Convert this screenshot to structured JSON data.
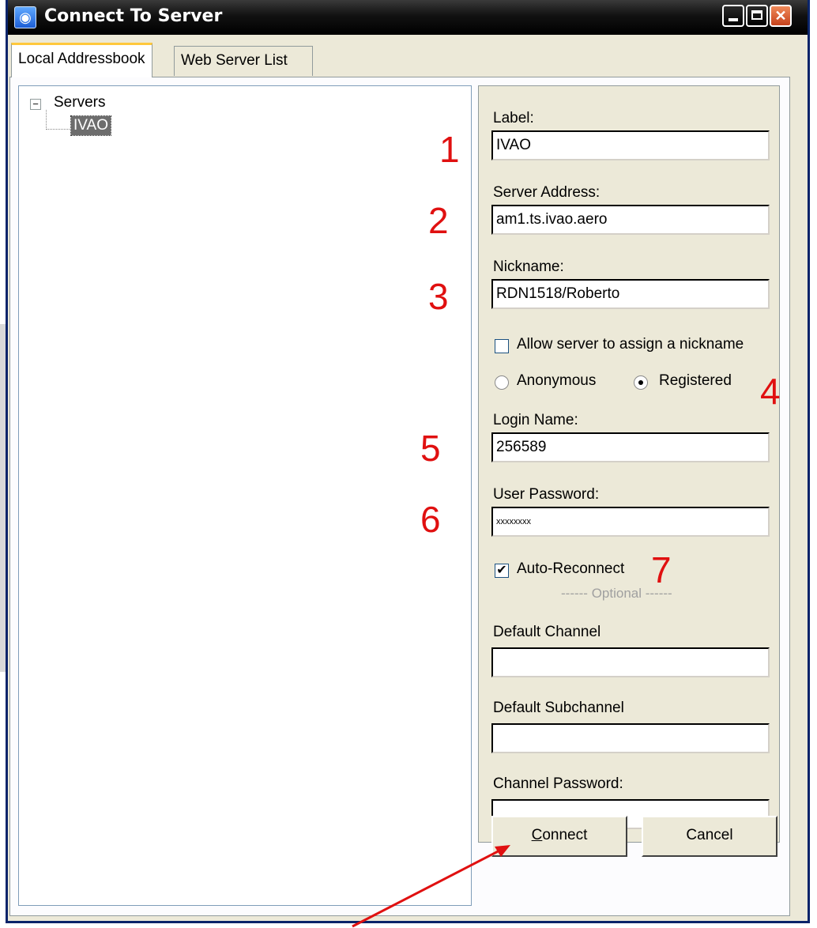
{
  "window": {
    "title": "Connect To Server"
  },
  "tabs": [
    "Local Addressbook",
    "Web Server List"
  ],
  "tree": {
    "root": "Servers",
    "child": "IVAO"
  },
  "form": {
    "label_caption": "Label:",
    "label_value": "IVAO",
    "server_caption": "Server Address:",
    "server_value": "am1.ts.ivao.aero",
    "nickname_caption": "Nickname:",
    "nickname_value": "RDN1518/Roberto",
    "allow_assign_label": "Allow server to assign a nickname",
    "allow_assign_checked": false,
    "anonymous_label": "Anonymous",
    "registered_label": "Registered",
    "login_caption": "Login Name:",
    "login_value": "256589",
    "password_caption": "User Password:",
    "password_value": "xxxxxxxx",
    "auto_reconnect_label": "Auto-Reconnect",
    "auto_reconnect_checked": true,
    "optional_label": "------ Optional ------",
    "default_channel_caption": "Default Channel",
    "default_channel_value": "",
    "default_subchannel_caption": "Default Subchannel",
    "default_subchannel_value": "",
    "channel_password_caption": "Channel Password:",
    "channel_password_value": ""
  },
  "buttons": {
    "connect_underlined": "C",
    "connect_rest": "onnect",
    "cancel": "Cancel"
  },
  "annotations": [
    "1",
    "2",
    "3",
    "4",
    "5",
    "6",
    "7"
  ],
  "colors": {
    "annotation": "#e01010",
    "title_bar": "#111111"
  }
}
